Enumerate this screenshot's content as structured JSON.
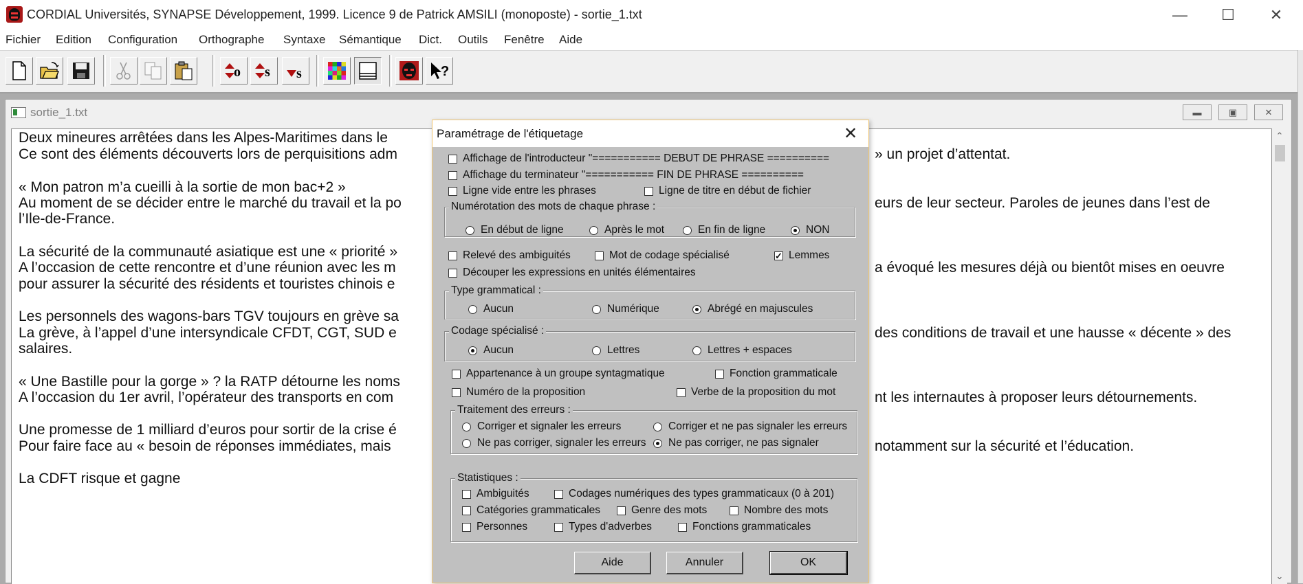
{
  "window": {
    "title": "CORDIAL Universités, SYNAPSE Développement, 1999. Licence 9 de Patrick AMSILI (monoposte) - sortie_1.txt",
    "controls": {
      "minimize": "—",
      "maximize": "☐",
      "close": "✕"
    }
  },
  "menu": [
    "Fichier",
    "Edition",
    "Configuration",
    "Orthographe",
    "Syntaxe",
    "Sémantique",
    "Dict.",
    "Outils",
    "Fenêtre",
    "Aide"
  ],
  "toolbar": {
    "buttons": [
      "new-file",
      "open-folder",
      "save",
      "cut",
      "copy",
      "paste",
      "tag-o",
      "tag-s-up",
      "tag-s-down",
      "color-grid",
      "panel-view",
      "mask",
      "help-cursor"
    ],
    "glyphs": {
      "tag_o": "o",
      "tag_s": "s",
      "help": "?"
    }
  },
  "document": {
    "title": "sortie_1.txt",
    "lines": [
      "Deux mineures arrêtées dans les Alpes-Maritimes dans le",
      "Ce sont des éléments découverts lors de perquisitions adm",
      "",
      "« Mon patron m’a cueilli à la sortie de mon bac+2 »",
      "Au moment de se décider entre le marché du travail et la po",
      "l’Ile-de-France.",
      "",
      "La sécurité de la communauté asiatique est une « priorité »",
      "A l’occasion de cette rencontre et d’une réunion avec les m",
      "pour assurer la sécurité des résidents et touristes chinois e",
      "",
      "Les personnels des wagons-bars TGV toujours en grève sa",
      "La grève, à l’appel d’une intersyndicale CFDT, CGT, SUD e",
      "salaires.",
      "",
      "« Une Bastille pour la gorge » ? la RATP détourne les noms",
      "A l’occasion du 1er avril, l’opérateur des transports en com",
      "",
      "Une promesse de 1 milliard d’euros pour sortir de la crise é",
      "Pour faire face au « besoin de réponses immédiates, mais",
      "",
      "La CDFT risque et gagne"
    ],
    "right_fragments": [
      {
        "line": 1,
        "text": "» un projet d’attentat."
      },
      {
        "line": 4,
        "text": "eurs de leur secteur. Paroles de jeunes dans l’est de"
      },
      {
        "line": 8,
        "text": "a évoqué les mesures déjà ou bientôt mises en oeuvre"
      },
      {
        "line": 12,
        "text": "des conditions de travail et une hausse « décente » des"
      },
      {
        "line": 16,
        "text": "nt les internautes à proposer leurs détournements."
      },
      {
        "line": 19,
        "text": "notamment sur la sécurité et l’éducation."
      }
    ]
  },
  "dialog": {
    "title": "Paramétrage de l'étiquetage",
    "close": "✕",
    "checks_top": [
      {
        "label": "Affichage de l'introducteur \"=========== DEBUT DE PHRASE ==========",
        "checked": false
      },
      {
        "label": "Affichage du terminateur \"=========== FIN DE PHRASE ==========",
        "checked": false
      },
      {
        "label": "Ligne vide entre les phrases",
        "checked": false
      },
      {
        "label": "Ligne de titre en début de fichier",
        "checked": false
      }
    ],
    "numbering": {
      "label": "Numérotation des mots de chaque phrase :",
      "options": [
        "En début de ligne",
        "Après le mot",
        "En fin de ligne",
        "NON"
      ],
      "selected": "NON"
    },
    "checks_mid": [
      {
        "label": "Relevé des ambiguités",
        "checked": false
      },
      {
        "label": "Mot de codage spécialisé",
        "checked": false
      },
      {
        "label": "Lemmes",
        "checked": true
      },
      {
        "label": "Découper les expressions en unités élémentaires",
        "checked": false
      }
    ],
    "gram_type": {
      "label": "Type grammatical :",
      "options": [
        "Aucun",
        "Numérique",
        "Abrégé en majuscules"
      ],
      "selected": "Abrégé en majuscules"
    },
    "special_code": {
      "label": "Codage spécialisé :",
      "options": [
        "Aucun",
        "Lettres",
        "Lettres + espaces"
      ],
      "selected": "Aucun"
    },
    "checks_low": [
      {
        "label": "Appartenance à un groupe syntagmatique",
        "checked": false
      },
      {
        "label": "Fonction grammaticale",
        "checked": false
      },
      {
        "label": "Numéro de la proposition",
        "checked": false
      },
      {
        "label": "Verbe de la proposition du mot",
        "checked": false
      }
    ],
    "errors": {
      "label": "Traitement des erreurs :",
      "options": [
        "Corriger et signaler les erreurs",
        "Corriger et ne pas signaler les erreurs",
        "Ne pas corriger, signaler les erreurs",
        "Ne pas corriger, ne pas signaler"
      ],
      "selected": "Ne pas corriger, ne pas signaler"
    },
    "stats": {
      "label": "Statistiques :",
      "items": [
        {
          "label": "Ambiguités",
          "checked": false
        },
        {
          "label": "Codages numériques des types grammaticaux (0 à 201)",
          "checked": false
        },
        {
          "label": "Catégories grammaticales",
          "checked": false
        },
        {
          "label": "Genre des mots",
          "checked": false
        },
        {
          "label": "Nombre des mots",
          "checked": false
        },
        {
          "label": "Personnes",
          "checked": false
        },
        {
          "label": "Types d'adverbes",
          "checked": false
        },
        {
          "label": "Fonctions grammaticales",
          "checked": false
        }
      ]
    },
    "buttons": {
      "help": "Aide",
      "cancel": "Annuler",
      "ok": "OK"
    }
  }
}
